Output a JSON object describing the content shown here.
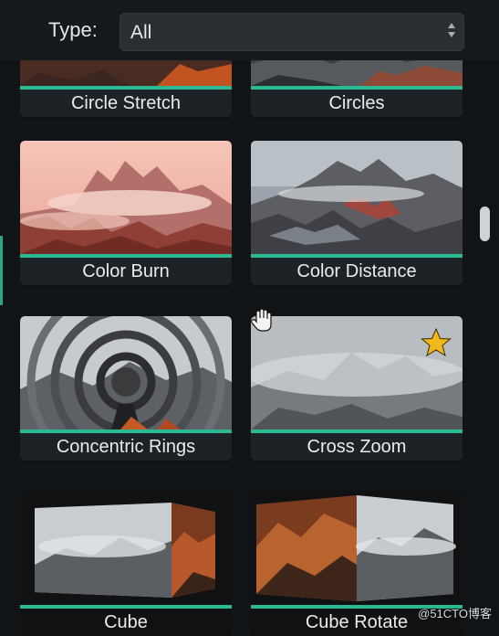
{
  "filter": {
    "label": "Type:",
    "value": "All"
  },
  "transitions": [
    {
      "name": "Circle Stretch"
    },
    {
      "name": "Circles"
    },
    {
      "name": "Color Burn"
    },
    {
      "name": "Color Distance"
    },
    {
      "name": "Concentric Rings"
    },
    {
      "name": "Cross Zoom",
      "favorite": true
    },
    {
      "name": "Cube"
    },
    {
      "name": "Cube Rotate"
    }
  ],
  "watermark": "@51CTO博客",
  "colors": {
    "accent": "#2bb892",
    "background": "#101417",
    "panel": "#1d2226"
  }
}
